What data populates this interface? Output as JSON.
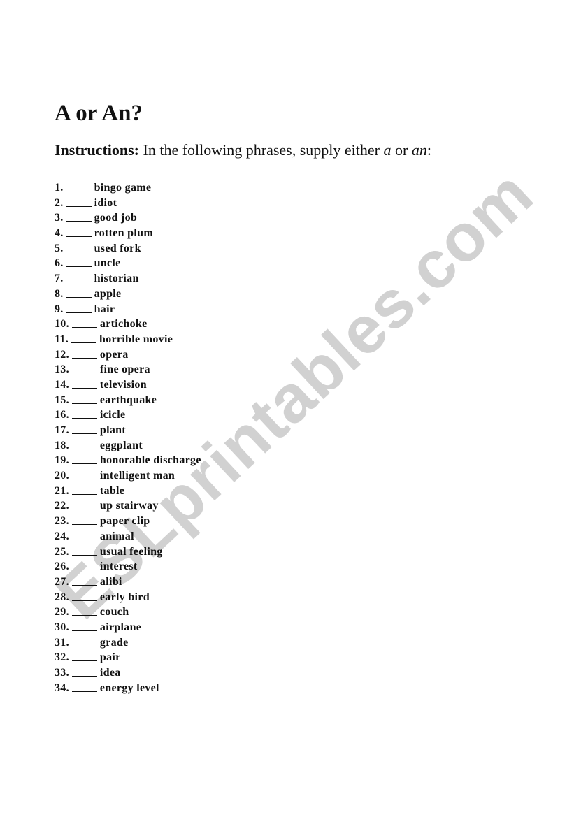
{
  "document": {
    "title": "A or An?",
    "instructions": {
      "label": "Instructions:",
      "text_before": " In the following phrases, supply either ",
      "option_a": "a",
      "text_middle": " or ",
      "option_an": "an",
      "text_after": ":"
    },
    "blank": "____",
    "items": [
      {
        "number": "1.",
        "phrase": "bingo game"
      },
      {
        "number": "2.",
        "phrase": "idiot"
      },
      {
        "number": "3.",
        "phrase": "good job"
      },
      {
        "number": "4.",
        "phrase": "rotten plum"
      },
      {
        "number": "5.",
        "phrase": "used fork"
      },
      {
        "number": "6.",
        "phrase": "uncle"
      },
      {
        "number": "7.",
        "phrase": "historian"
      },
      {
        "number": "8.",
        "phrase": "apple"
      },
      {
        "number": "9.",
        "phrase": "hair"
      },
      {
        "number": "10.",
        "phrase": "artichoke"
      },
      {
        "number": "11.",
        "phrase": "horrible movie"
      },
      {
        "number": "12.",
        "phrase": "opera"
      },
      {
        "number": "13.",
        "phrase": "fine opera"
      },
      {
        "number": "14.",
        "phrase": "television"
      },
      {
        "number": "15.",
        "phrase": "earthquake"
      },
      {
        "number": "16.",
        "phrase": "icicle"
      },
      {
        "number": "17.",
        "phrase": "plant"
      },
      {
        "number": "18.",
        "phrase": "eggplant"
      },
      {
        "number": "19.",
        "phrase": "honorable discharge"
      },
      {
        "number": "20.",
        "phrase": "intelligent man"
      },
      {
        "number": "21.",
        "phrase": "table"
      },
      {
        "number": "22.",
        "phrase": "up stairway"
      },
      {
        "number": "23.",
        "phrase": "paper clip"
      },
      {
        "number": "24.",
        "phrase": "animal"
      },
      {
        "number": "25.",
        "phrase": "usual feeling"
      },
      {
        "number": "26.",
        "phrase": "interest"
      },
      {
        "number": "27.",
        "phrase": "alibi"
      },
      {
        "number": "28.",
        "phrase": "early bird"
      },
      {
        "number": "29.",
        "phrase": "couch"
      },
      {
        "number": "30.",
        "phrase": "airplane"
      },
      {
        "number": "31.",
        "phrase": "grade"
      },
      {
        "number": "32.",
        "phrase": "pair"
      },
      {
        "number": "33.",
        "phrase": "idea"
      },
      {
        "number": "34.",
        "phrase": "energy level"
      }
    ]
  },
  "watermark": {
    "text": "ESLprintables.com",
    "color": "#c9c9c9"
  }
}
